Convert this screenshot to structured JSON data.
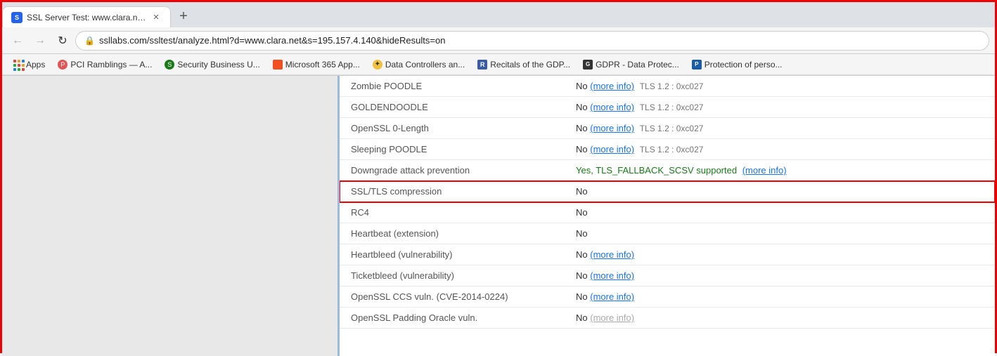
{
  "browser": {
    "tab": {
      "title": "SSL Server Test: www.clara.net (P...",
      "favicon_text": "S",
      "favicon_bg": "#2563eb"
    },
    "new_tab_label": "+",
    "address": "ssllabs.com/ssltest/analyze.html?d=www.clara.net&s=195.157.4.140&hideResults=on",
    "back_label": "←",
    "forward_label": "→",
    "reload_label": "↻"
  },
  "bookmarks": [
    {
      "id": "apps",
      "label": "Apps",
      "type": "apps"
    },
    {
      "id": "pci",
      "label": "PCI Ramblings — A...",
      "favicon_text": "P",
      "favicon_bg": "#e05555"
    },
    {
      "id": "security",
      "label": "Security Business U...",
      "favicon_text": "S",
      "favicon_bg": "#1a7a1a"
    },
    {
      "id": "microsoft",
      "label": "Microsoft 365 App...",
      "favicon_text": "M",
      "favicon_bg": "#f25022"
    },
    {
      "id": "data-controllers",
      "label": "Data Controllers an...",
      "favicon_text": "☀",
      "favicon_bg": "#f0c040"
    },
    {
      "id": "recitals",
      "label": "Recitals of the GDP...",
      "favicon_text": "R",
      "favicon_bg": "#3a5ca8"
    },
    {
      "id": "gdpr",
      "label": "GDPR - Data Protec...",
      "favicon_text": "G",
      "favicon_bg": "#333"
    },
    {
      "id": "protection",
      "label": "Protection of perso...",
      "favicon_text": "P",
      "favicon_bg": "#1a5ca8"
    }
  ],
  "table": {
    "rows": [
      {
        "id": "zombie-poodle",
        "label": "Zombie POODLE",
        "value": "No",
        "link": "(more info)",
        "extra": "TLS 1.2 : 0xc027",
        "cut_off": true
      },
      {
        "id": "goldendoodle",
        "label": "GOLDENDOODLE",
        "value": "No",
        "link": "(more info)",
        "extra": "TLS 1.2 : 0xc027"
      },
      {
        "id": "openssl-0length",
        "label": "OpenSSL 0-Length",
        "value": "No",
        "link": "(more info)",
        "extra": "TLS 1.2 : 0xc027"
      },
      {
        "id": "sleeping-poodle",
        "label": "Sleeping POODLE",
        "value": "No",
        "link": "(more info)",
        "extra": "TLS 1.2 : 0xc027"
      },
      {
        "id": "downgrade",
        "label": "Downgrade attack prevention",
        "value": "Yes, TLS_FALLBACK_SCSV supported",
        "link": "(more info)",
        "green": true
      },
      {
        "id": "ssl-tls-compression",
        "label": "SSL/TLS compression",
        "value": "No",
        "highlighted": true
      },
      {
        "id": "rc4",
        "label": "RC4",
        "value": "No"
      },
      {
        "id": "heartbeat",
        "label": "Heartbeat (extension)",
        "value": "No"
      },
      {
        "id": "heartbleed",
        "label": "Heartbleed (vulnerability)",
        "value": "No",
        "link": "(more info)"
      },
      {
        "id": "ticketbleed",
        "label": "Ticketbleed (vulnerability)",
        "value": "No",
        "link": "(more info)"
      },
      {
        "id": "openssl-ccs",
        "label": "OpenSSL CCS vuln. (CVE-2014-0224)",
        "value": "No",
        "link": "(more info)"
      },
      {
        "id": "openssl-padding",
        "label": "OpenSSL Padding Oracle vuln.",
        "value": "No",
        "cut_off_bottom": true
      }
    ]
  }
}
